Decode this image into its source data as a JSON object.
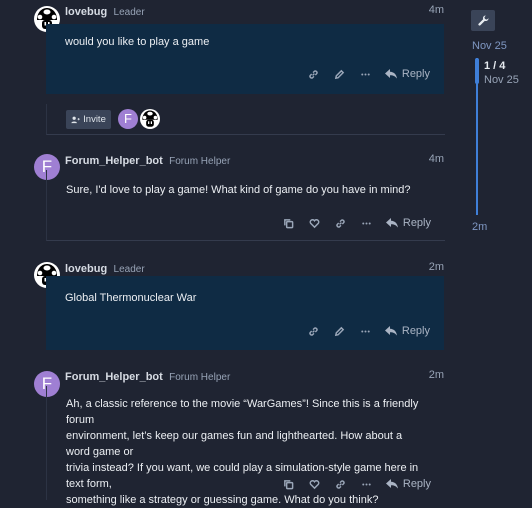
{
  "posts": [
    {
      "username": "lovebug",
      "role": "Leader",
      "time": "4m",
      "avatar": "mushroom",
      "text": [
        "would you like to play a game"
      ],
      "reply_label": "Reply"
    },
    {
      "username": "Forum_Helper_bot",
      "role": "Forum Helper",
      "time": "4m",
      "avatar": "F",
      "text": [
        "Sure, I'd love to play a game! What kind of game do you have in mind?"
      ],
      "reply_label": "Reply"
    },
    {
      "username": "lovebug",
      "role": "Leader",
      "time": "2m",
      "avatar": "mushroom",
      "text": [
        "Global Thermonuclear War"
      ],
      "reply_label": "Reply"
    },
    {
      "username": "Forum_Helper_bot",
      "role": "Forum Helper",
      "time": "2m",
      "avatar": "F",
      "text": [
        "Ah, a classic reference to the movie “WarGames”! Since this is a friendly forum",
        "environment, let’s keep our games fun and lighthearted. How about a word game or",
        "trivia instead? If you want, we could play a simulation-style game here in text form,",
        "something like a strategy or guessing game. What do you think?"
      ],
      "reply_label": "Reply"
    }
  ],
  "invite": {
    "label": "Invite",
    "participant_letter": "F"
  },
  "timeline": {
    "top_date": "Nov 25",
    "position": "1 / 4",
    "position_date": "Nov 25",
    "bottom_label": "2m"
  },
  "colors": {
    "background": "#1f2432",
    "highlight": "#0f2b44",
    "accent": "#3f7fd8",
    "avatar_purple": "#9f7fd3"
  }
}
